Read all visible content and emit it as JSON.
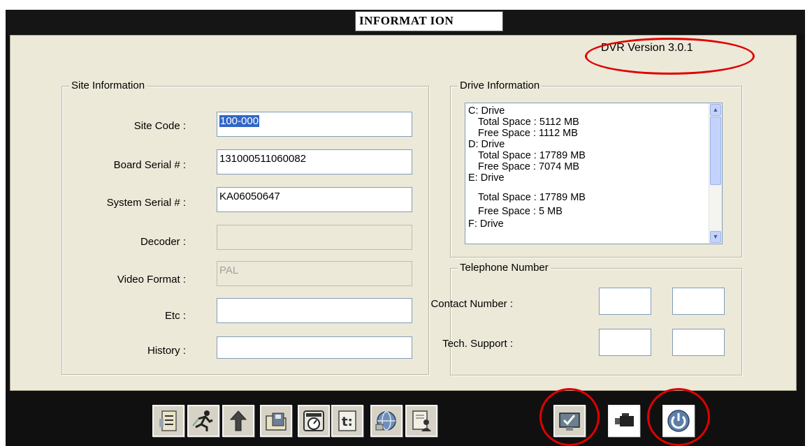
{
  "window": {
    "title": "INFORMAT ION",
    "version": "DVR Version 3.0.1"
  },
  "site_information": {
    "legend": "Site Information",
    "fields": [
      {
        "label": "Site Code :",
        "value": "100-000",
        "enabled": true,
        "selected": true
      },
      {
        "label": "Board Serial # :",
        "value": "131000511060082",
        "enabled": true
      },
      {
        "label": "System Serial # :",
        "value": "KA06050647",
        "enabled": true
      },
      {
        "label": "Decoder :",
        "value": "",
        "enabled": false
      },
      {
        "label": "Video Format :",
        "value": "PAL",
        "enabled": false
      },
      {
        "label": "Etc :",
        "value": "",
        "enabled": true
      },
      {
        "label": "History :",
        "value": "",
        "enabled": true
      }
    ]
  },
  "drive_information": {
    "legend": "Drive Information",
    "lines": [
      "C: Drive",
      "Total Space : 5112 MB",
      "Free Space : 1112 MB",
      "D: Drive",
      "Total Space : 17789 MB",
      "Free Space : 7074 MB",
      "E: Drive",
      "Total Space : 17789 MB",
      "Free Space : 5 MB",
      "F: Drive"
    ],
    "scroll_up": "▲",
    "scroll_down": "▼"
  },
  "telephone": {
    "legend": "Telephone Number",
    "contact_label": "Contact Number :",
    "tech_label": "Tech. Support :"
  },
  "toolbar": {
    "buttons": [
      {
        "icon": "file-cabinet-icon"
      },
      {
        "icon": "running-person-icon"
      },
      {
        "icon": "upload-arrow-icon"
      },
      {
        "icon": "disk-folder-icon"
      },
      {
        "icon": "clock-icon"
      },
      {
        "icon": "list-document-icon"
      },
      {
        "icon": "network-globe-icon"
      },
      {
        "icon": "document-person-icon"
      },
      {
        "icon": "monitor-check-icon",
        "highlighted": true
      },
      {
        "icon": "camera-icon"
      },
      {
        "icon": "power-icon",
        "highlighted": true
      }
    ]
  },
  "colors": {
    "highlight_ring": "#e00000",
    "panel_bg": "#ece9d8",
    "selection": "#3166c6"
  }
}
